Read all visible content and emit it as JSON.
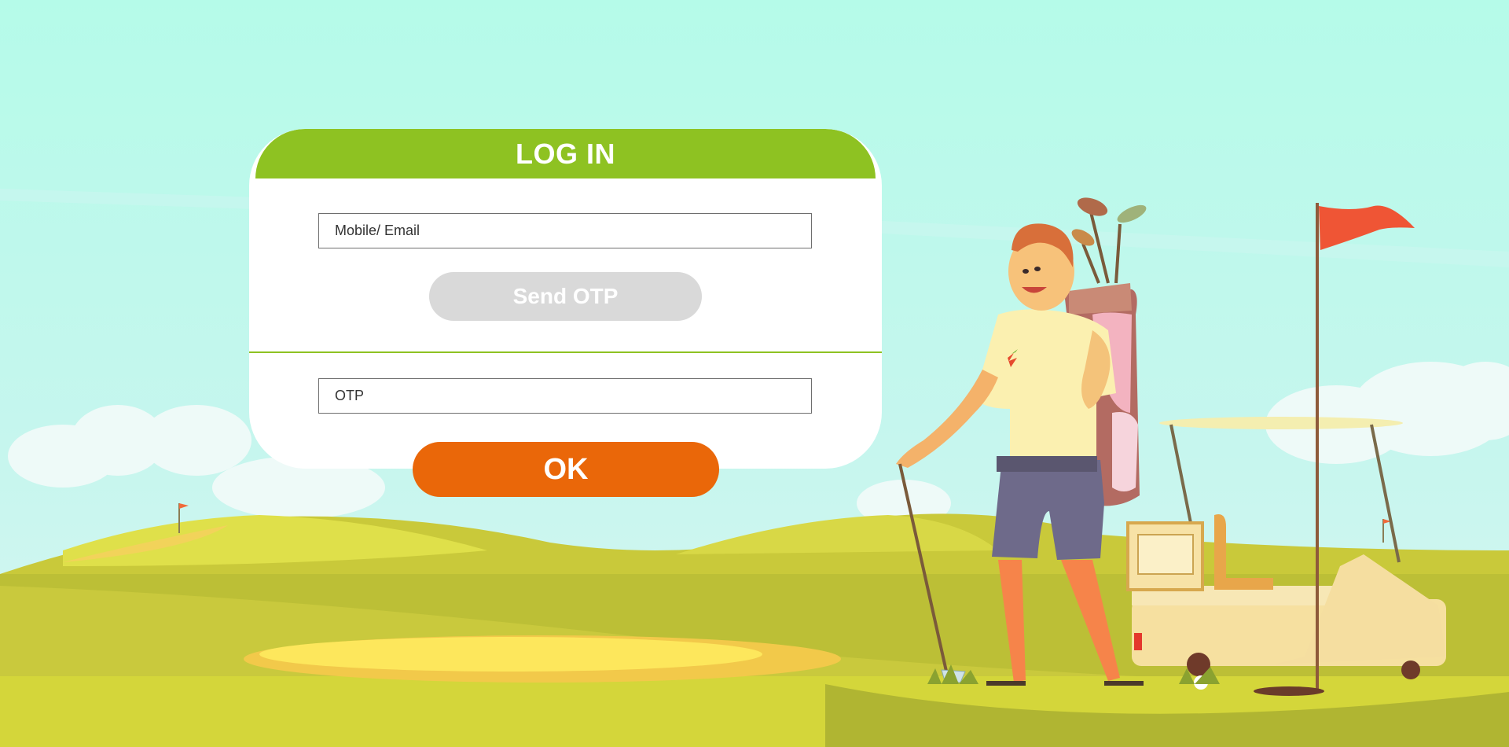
{
  "login": {
    "title": "LOG IN",
    "mobile_email_placeholder": "Mobile/ Email",
    "send_otp_label": "Send OTP",
    "otp_placeholder": "OTP",
    "ok_label": "OK"
  },
  "theme": {
    "header_green": "#8ec222",
    "ok_orange": "#ea6709",
    "send_otp_disabled_gray": "#d9d9d9",
    "sky_top": "#b3fbe9",
    "grass": "#d4d63a"
  }
}
